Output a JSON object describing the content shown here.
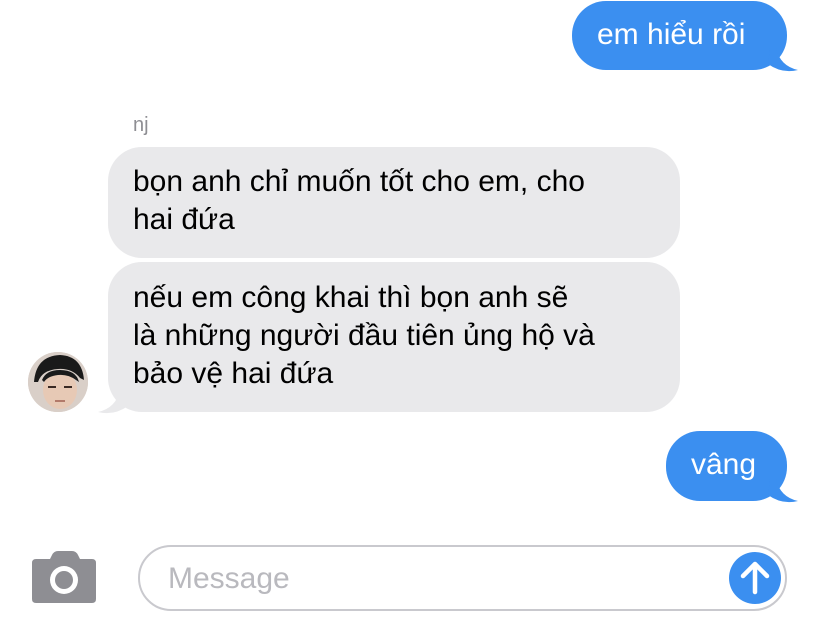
{
  "conversation": {
    "sender_name": "nj",
    "messages": [
      {
        "direction": "outgoing",
        "lines": [
          "em hiểu rồi"
        ]
      },
      {
        "direction": "incoming",
        "lines": [
          "bọn anh chỉ muốn tốt cho em, cho",
          "hai đứa"
        ]
      },
      {
        "direction": "incoming",
        "lines": [
          "nếu em công khai thì bọn anh sẽ",
          "là những người đầu tiên ủng hộ và",
          "bảo vệ hai đứa"
        ]
      },
      {
        "direction": "outgoing",
        "lines": [
          "vâng"
        ]
      }
    ]
  },
  "composer": {
    "placeholder": "Message",
    "camera_icon": "camera-icon",
    "send_icon": "arrow-up-icon"
  },
  "colors": {
    "outgoing_bubble": "#3b8ff0",
    "incoming_bubble": "#e9e9eb",
    "placeholder_text": "#b9b9be",
    "camera_icon": "#8e8e93"
  }
}
